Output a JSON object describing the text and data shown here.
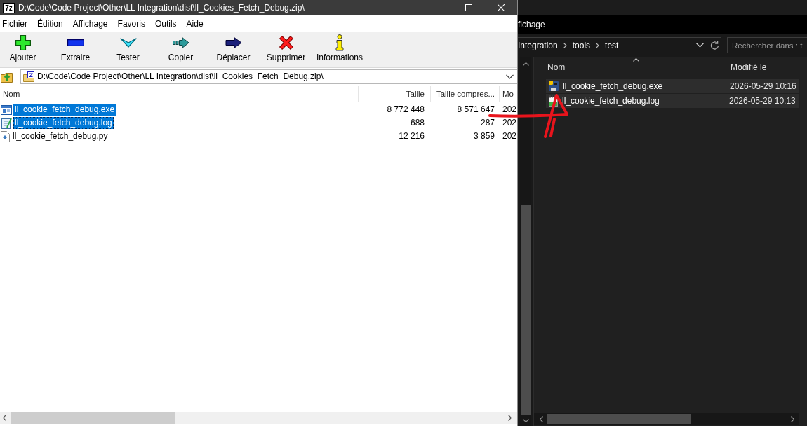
{
  "archive_window": {
    "logo": "7z",
    "title": "D:\\Code\\Code Project\\Other\\LL Integration\\dist\\ll_Cookies_Fetch_Debug.zip\\",
    "menu": [
      "Fichier",
      "Édition",
      "Affichage",
      "Favoris",
      "Outils",
      "Aide"
    ],
    "toolbar": [
      {
        "kind": "add",
        "label": "Ajouter"
      },
      {
        "kind": "extract",
        "label": "Extraire"
      },
      {
        "kind": "test",
        "label": "Tester"
      },
      {
        "kind": "copy",
        "label": "Copier"
      },
      {
        "kind": "move",
        "label": "Déplacer"
      },
      {
        "kind": "delete",
        "label": "Supprimer"
      },
      {
        "kind": "info",
        "label": "Informations"
      }
    ],
    "address": "D:\\Code\\Code Project\\Other\\LL Integration\\dist\\ll_Cookies_Fetch_Debug.zip\\",
    "columns": [
      "Nom",
      "Taille",
      "Taille compres...",
      "Mo"
    ],
    "files": [
      {
        "kind": "exe",
        "selected": true,
        "focused": false,
        "cells": [
          "ll_cookie_fetch_debug.exe",
          "8 772 448",
          "8 571 647",
          "202"
        ]
      },
      {
        "kind": "log",
        "selected": true,
        "focused": true,
        "cells": [
          "ll_cookie_fetch_debug.log",
          "688",
          "287",
          "202"
        ]
      },
      {
        "kind": "py",
        "selected": false,
        "focused": false,
        "cells": [
          "ll_cookie_fetch_debug.py",
          "12 216",
          "3 859",
          "202"
        ]
      }
    ]
  },
  "explorer_window": {
    "menu": [
      "fichage"
    ],
    "breadcrumb": [
      "Integration",
      "tools",
      "test"
    ],
    "search": {
      "placeholder": "Rechercher dans : t"
    },
    "columns": [
      "Nom",
      "Modifié le"
    ],
    "files": [
      {
        "kind": "exe",
        "selected": true,
        "name": "ll_cookie_fetch_debug.exe",
        "modified": "2026-05-29 10:16"
      },
      {
        "kind": "log",
        "selected": true,
        "name": "ll_cookie_fetch_debug.log",
        "modified": "2026-05-29 10:13"
      }
    ]
  }
}
